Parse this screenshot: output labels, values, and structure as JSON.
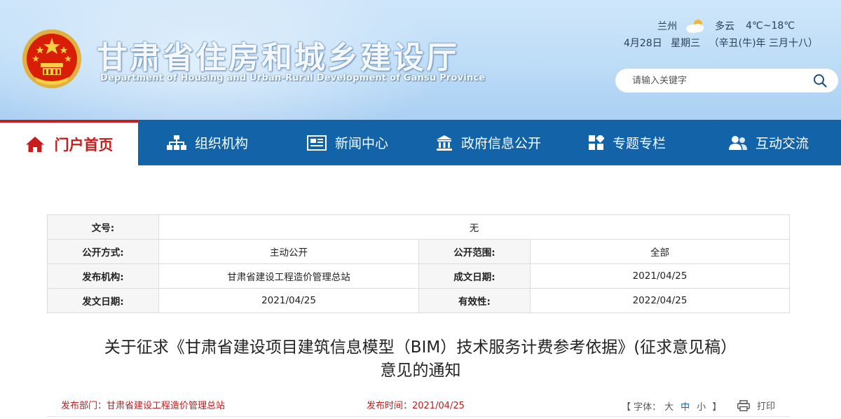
{
  "header": {
    "title": "甘肃省住房和城乡建设厅",
    "subtitle": "Department of Housing and Urban-Rural Development of Gansu Province",
    "emblem_icon": "national-emblem-icon"
  },
  "weather": {
    "city": "兰州",
    "icon": "partly-cloudy-icon",
    "condition": "多云",
    "temperature": "4℃~18℃"
  },
  "date": {
    "day": "4月28日",
    "weekday": "星期三",
    "lunar": "（辛丑(牛)年 三月十八）"
  },
  "search": {
    "placeholder": "请输入关键字",
    "icon": "search-icon"
  },
  "nav": {
    "items": [
      {
        "label": "门户首页",
        "icon": "home-icon",
        "active": true
      },
      {
        "label": "组织机构",
        "icon": "org-chart-icon"
      },
      {
        "label": "新闻中心",
        "icon": "news-icon"
      },
      {
        "label": "政府信息公开",
        "icon": "government-building-icon"
      },
      {
        "label": "专题专栏",
        "icon": "grid-icon"
      },
      {
        "label": "互动交流",
        "icon": "users-icon"
      }
    ]
  },
  "info": {
    "doc_no_label": "文号:",
    "doc_no_value": "无",
    "disclosure_method_label": "公开方式:",
    "disclosure_method_value": "主动公开",
    "disclosure_scope_label": "公开范围:",
    "disclosure_scope_value": "全部",
    "publisher_label": "发布机构:",
    "publisher_value": "甘肃省建设工程造价管理总站",
    "created_date_label": "成文日期:",
    "created_date_value": "2021/04/25",
    "issued_date_label": "发文日期:",
    "issued_date_value": "2021/04/25",
    "validity_label": "有效性:",
    "validity_value": "2022/04/25"
  },
  "article": {
    "title_line1": "关于征求《甘肃省建设项目建筑信息模型（BIM）技术服务计费参考依据》(征求意见稿）",
    "title_line2": "意见的通知",
    "dept_label": "发布部门：",
    "dept_value": "甘肃省建设工程造价管理总站",
    "time_label": "发布时间：",
    "time_value": "2021/04/25"
  },
  "tools": {
    "font_open": "【 字体：",
    "font_large": "大",
    "font_medium": "中",
    "font_small": "小",
    "font_close": " 】",
    "print_label": "打印",
    "print_icon": "printer-icon"
  },
  "colors": {
    "nav_bg": "#1363a8",
    "accent_red": "#c91d1d",
    "header_bg": "#bcdcf7"
  }
}
